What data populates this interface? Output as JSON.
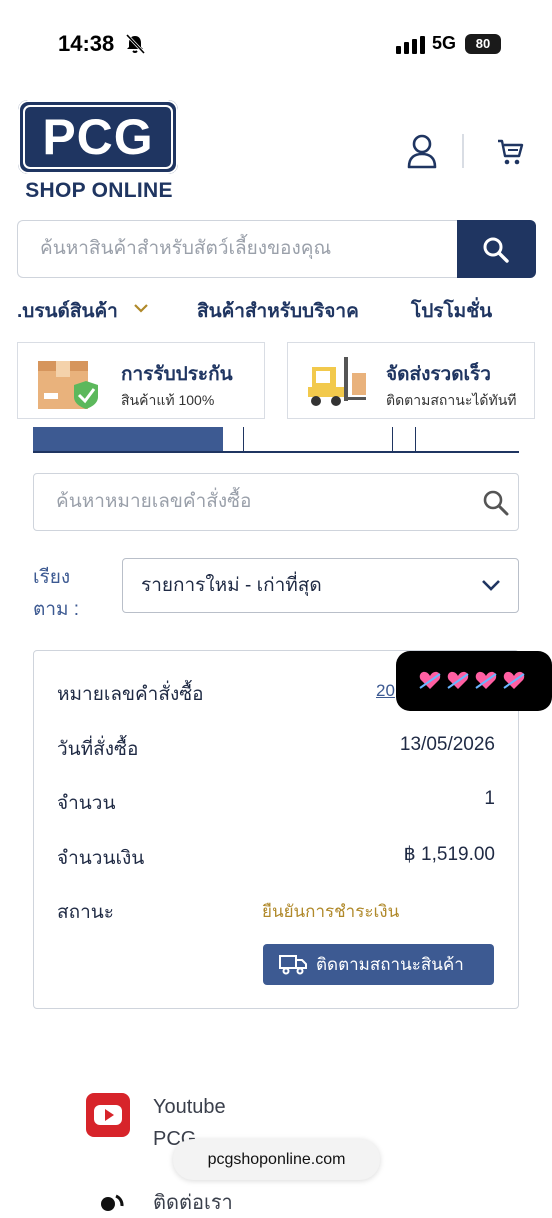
{
  "status_bar": {
    "time": "14:38",
    "network": "5G",
    "battery": "80"
  },
  "brand": {
    "logo": "PCG",
    "tagline": "SHOP ONLINE",
    "color": "#1f3561"
  },
  "search": {
    "placeholder": "ค้นหาสินค้าสำหรับสัตว์เลี้ยงของคุณ"
  },
  "nav": {
    "items": [
      ".บรนด์สินค้า",
      "สินค้าสำหรับบริจาค",
      "โปรโมชั่น"
    ]
  },
  "features": [
    {
      "title": "การรับประกัน",
      "subtitle": "สินค้าแท้ 100%",
      "icon": "warranty-box-icon"
    },
    {
      "title": "จัดส่งรวดเร็ว",
      "subtitle": "ติดตามสถานะได้ทันที",
      "icon": "forklift-icon"
    }
  ],
  "order_search": {
    "placeholder": "ค้นหาหมายเลขคำสั่งซื้อ"
  },
  "sort": {
    "label_line1": "เรียง",
    "label_line2": "ตาม :",
    "selected": "รายการใหม่ - เก่าที่สุด"
  },
  "order": {
    "number_label": "หมายเลขคำสั่งซื้อ",
    "number_value": "20",
    "date_label": "วันที่สั่งซื้อ",
    "date_value": "13/05/2026",
    "qty_label": "จำนวน",
    "qty_value": "1",
    "amount_label": "จำนวนเงิน",
    "amount_value": "฿ 1,519.00",
    "status_label": "สถานะ",
    "status_value": "ยืนยันการชำระเงิน",
    "track_button": "ติดตามสถานะสินค้า",
    "status_color": "#b0892a",
    "accent_color": "#3d5a92"
  },
  "progress": {
    "fill_fraction": 0.39
  },
  "footer": {
    "youtube_label": "Youtube",
    "youtube_sub": "PCG",
    "contact_label": "ติดต่อเรา",
    "url": "pcgshoponline.com"
  }
}
